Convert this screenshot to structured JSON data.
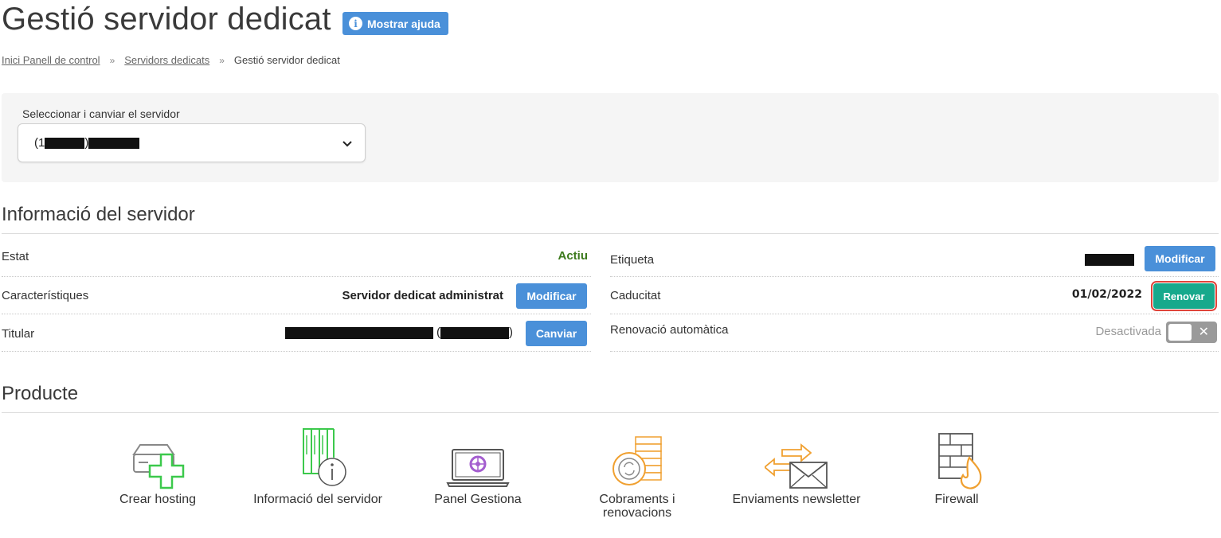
{
  "header": {
    "title": "Gestió servidor dedicat",
    "help_button": "Mostrar ajuda",
    "help_icon": "info-icon"
  },
  "breadcrumb": {
    "items": [
      "Inici Panell de control",
      "Servidors dedicats",
      "Gestió servidor dedicat"
    ],
    "separator": "»"
  },
  "server_selector": {
    "label": "Seleccionar i canviar el servidor",
    "prefix": "(1",
    "middle": ")"
  },
  "server_info": {
    "title": "Informació del servidor",
    "left": {
      "status_label": "Estat",
      "status_value": "Actiu",
      "features_label": "Característiques",
      "features_value": "Servidor dedicat administrat",
      "features_button": "Modificar",
      "owner_label": "Titular",
      "owner_paren_open": "(",
      "owner_paren_close": ")",
      "owner_button": "Canviar"
    },
    "right": {
      "tag_label": "Etiqueta",
      "tag_button": "Modificar",
      "expiry_label": "Caducitat",
      "expiry_value": "01/02/2022",
      "expiry_button": "Renovar",
      "autorenew_label": "Renovació automàtica",
      "autorenew_value": "Desactivada",
      "autorenew_enabled": false
    }
  },
  "product": {
    "title": "Producte",
    "items": [
      {
        "label": "Crear hosting",
        "icon": "server-add-icon"
      },
      {
        "label": "Informació del servidor",
        "icon": "server-info-icon"
      },
      {
        "label": "Panel Gestiona",
        "icon": "laptop-panel-icon"
      },
      {
        "label": "Cobraments i renovacions",
        "icon": "coins-renew-icon"
      },
      {
        "label": "Enviaments newsletter",
        "icon": "newsletter-icon"
      },
      {
        "label": "Firewall",
        "icon": "firewall-icon"
      }
    ]
  },
  "colors": {
    "primary": "#4a90d9",
    "success": "#17a98c",
    "status_active": "#3c7a1c",
    "highlight": "#e0443a",
    "icon_green": "#3cc94c",
    "icon_orange": "#f0a030"
  }
}
